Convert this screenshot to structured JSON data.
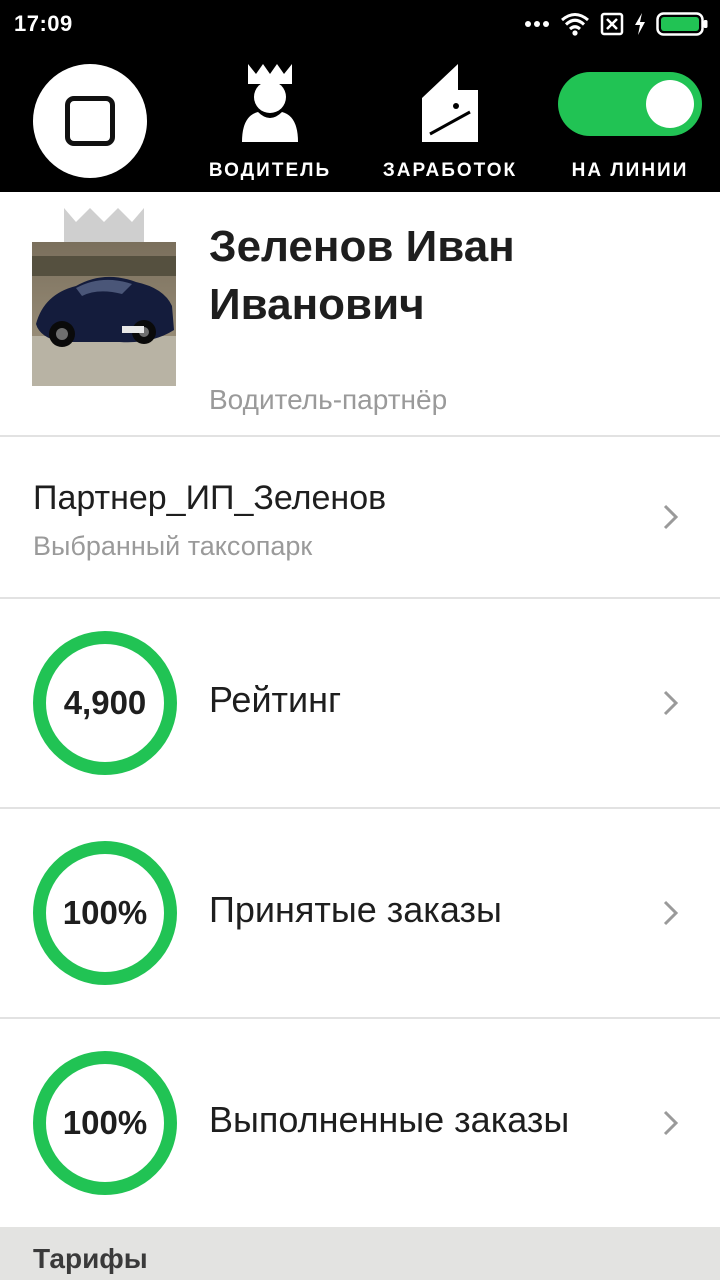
{
  "status_bar": {
    "time": "17:09",
    "icons": [
      "dots-icon",
      "wifi-icon",
      "sim-blocked-icon",
      "charging-icon",
      "battery-icon"
    ]
  },
  "nav": {
    "home_icon": "square-icon",
    "items": [
      {
        "label": "ВОДИТЕЛЬ",
        "icon": "driver-crown-icon"
      },
      {
        "label": "ЗАРАБОТОК",
        "icon": "wallet-icon"
      },
      {
        "label": "НА ЛИНИИ",
        "icon": "toggle-switch",
        "state": "on"
      }
    ]
  },
  "profile": {
    "name": "Зеленов Иван Иванович",
    "role": "Водитель-партнёр",
    "photo": "car-photo"
  },
  "park": {
    "title": "Партнер_ИП_Зеленов",
    "subtitle": "Выбранный таксопарк"
  },
  "metrics": [
    {
      "value": "4,900",
      "label": "Рейтинг"
    },
    {
      "value": "100%",
      "label": "Принятые заказы"
    },
    {
      "value": "100%",
      "label": "Выполненные заказы"
    }
  ],
  "section": {
    "title": "Тарифы"
  },
  "colors": {
    "accent_green": "#21c354",
    "bar_background": "#000000",
    "section_background": "#e3e3e1"
  }
}
